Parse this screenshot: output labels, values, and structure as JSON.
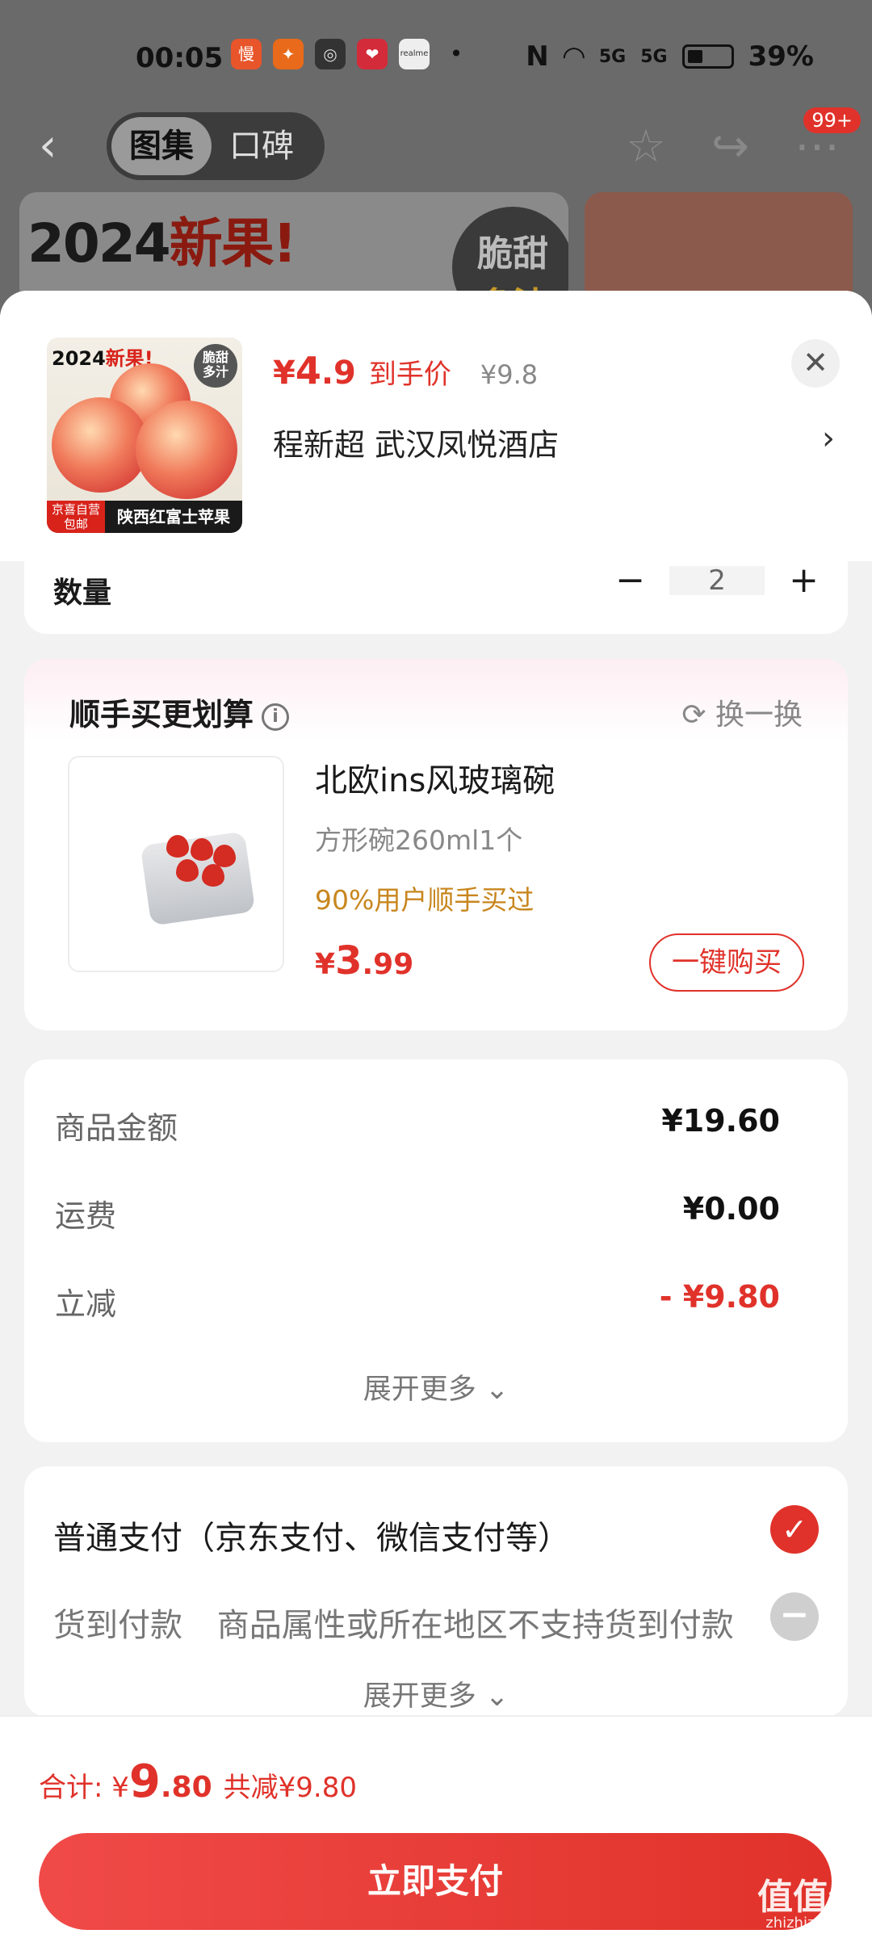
{
  "status_bar": {
    "time": "00:05",
    "network": "5G",
    "battery": "39%",
    "apps": [
      "慢",
      "✦",
      "◎",
      "❤",
      "realme",
      "•"
    ]
  },
  "top_nav": {
    "tabs": [
      "图集",
      "口碑"
    ],
    "active_tab": "图集",
    "badge": "99+"
  },
  "banner": {
    "year": "2024",
    "headline": "新果!",
    "circle": [
      "脆甜",
      "多汁"
    ]
  },
  "product": {
    "image_year": "2024",
    "image_title": "新果!",
    "image_tag": [
      "脆甜",
      "多汁"
    ],
    "image_badge": [
      "京喜自营",
      "包邮"
    ],
    "image_name": "陕西红富士苹果",
    "price_symbol": "¥",
    "price_int": "4",
    "price_dec": ".9",
    "price_label": "到手价",
    "original_price": "¥9.8",
    "address": "程新超  武汉凤悦酒店"
  },
  "quantity": {
    "label": "数量",
    "value": "2",
    "minus": "−",
    "plus": "+"
  },
  "recommend": {
    "title": "顺手买更划算",
    "refresh_label": "换一换",
    "name": "北欧ins风玻璃碗",
    "spec": "方形碗260ml1个",
    "social": "90%用户顺手买过",
    "price_symbol": "¥",
    "price_int": "3",
    "price_dec": ".99",
    "buy_label": "一键购买"
  },
  "summary": {
    "rows": [
      {
        "label": "商品金额",
        "value": "¥19.60"
      },
      {
        "label": "运费",
        "value": "¥0.00"
      },
      {
        "label": "立减",
        "value": "- ¥9.80"
      }
    ],
    "expand_label": "展开更多 ⌄"
  },
  "payment": {
    "normal": "普通支付（京东支付、微信支付等）",
    "cod_label": "货到付款",
    "cod_note": "商品属性或所在地区不支持货到付款",
    "expand_label": "展开更多 ⌄"
  },
  "footer": {
    "total_label": "合计: ¥",
    "total_int": "9",
    "total_dec": ".80",
    "discount": "共减¥9.80",
    "pay_button": "立即支付"
  },
  "watermark": {
    "text": "值值值",
    "domain": "zhizhizhi.com"
  },
  "colors": {
    "accent": "#e0322a",
    "social": "#c8861e"
  }
}
